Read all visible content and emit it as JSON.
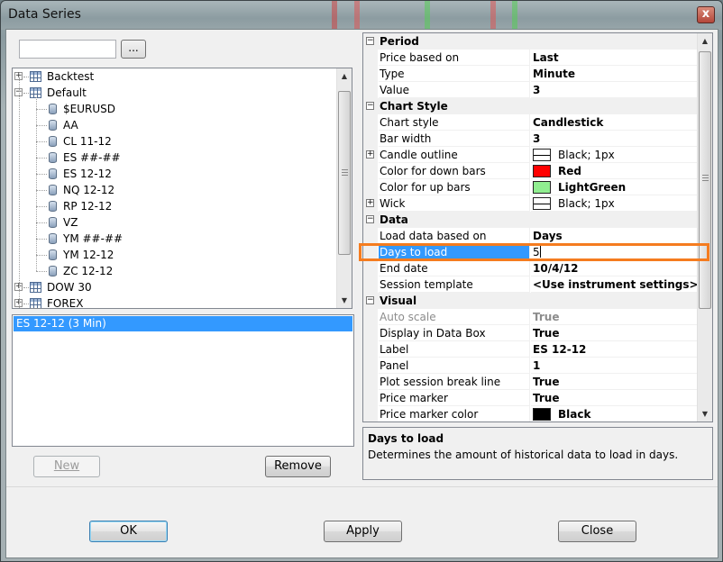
{
  "window": {
    "title": "Data Series",
    "close_label": "x"
  },
  "left": {
    "search": {
      "value": "",
      "placeholder": ""
    },
    "browse_label": "...",
    "tree": [
      {
        "label": "Backtest",
        "type": "folder",
        "expander": "+"
      },
      {
        "label": "Default",
        "type": "folder",
        "expander": "−"
      },
      {
        "label": "$EURUSD",
        "type": "instrument"
      },
      {
        "label": "AA",
        "type": "instrument"
      },
      {
        "label": "CL 11-12",
        "type": "instrument"
      },
      {
        "label": "ES ##-##",
        "type": "instrument"
      },
      {
        "label": "ES 12-12",
        "type": "instrument"
      },
      {
        "label": "NQ 12-12",
        "type": "instrument"
      },
      {
        "label": "RP 12-12",
        "type": "instrument"
      },
      {
        "label": "VZ",
        "type": "instrument"
      },
      {
        "label": "YM ##-##",
        "type": "instrument"
      },
      {
        "label": "YM 12-12",
        "type": "instrument"
      },
      {
        "label": "ZC 12-12",
        "type": "instrument"
      },
      {
        "label": "DOW 30",
        "type": "folder",
        "expander": "+"
      },
      {
        "label": "FOREX",
        "type": "folder",
        "expander": "+"
      }
    ],
    "series": [
      "ES 12-12 (3 Min)"
    ],
    "new_label": "New",
    "remove_label": "Remove"
  },
  "properties": {
    "categories": [
      {
        "name": "Period",
        "expander": "−",
        "rows": [
          {
            "name": "Price based on",
            "value": "Last"
          },
          {
            "name": "Type",
            "value": "Minute"
          },
          {
            "name": "Value",
            "value": "3"
          }
        ]
      },
      {
        "name": "Chart Style",
        "expander": "−",
        "rows": [
          {
            "name": "Chart style",
            "value": "Candlestick"
          },
          {
            "name": "Bar width",
            "value": "3"
          },
          {
            "name": "Candle outline",
            "value": "Black; 1px",
            "expander": "+",
            "swatch": "line"
          },
          {
            "name": "Color for down bars",
            "value": "Red",
            "swatch": "#ff0000"
          },
          {
            "name": "Color for up bars",
            "value": "LightGreen",
            "swatch": "#90ee90"
          },
          {
            "name": "Wick",
            "value": "Black; 1px",
            "expander": "+",
            "swatch": "line"
          }
        ]
      },
      {
        "name": "Data",
        "expander": "−",
        "rows": [
          {
            "name": "Load data based on",
            "value": "Days"
          },
          {
            "name": "Days to load",
            "value": "5",
            "selected": true
          },
          {
            "name": "End date",
            "value": "10/4/12"
          },
          {
            "name": "Session template",
            "value": "<Use instrument settings>"
          }
        ]
      },
      {
        "name": "Visual",
        "expander": "−",
        "rows": [
          {
            "name": "Auto scale",
            "value": "True",
            "dim": true
          },
          {
            "name": "Display in Data Box",
            "value": "True"
          },
          {
            "name": "Label",
            "value": "ES 12-12"
          },
          {
            "name": "Panel",
            "value": "1"
          },
          {
            "name": "Plot session break line",
            "value": "True"
          },
          {
            "name": "Price marker",
            "value": "True"
          },
          {
            "name": "Price marker color",
            "value": "Black",
            "swatch": "#000000"
          }
        ]
      }
    ],
    "description": {
      "title": "Days to load",
      "text": "Determines the amount of historical data to load in days."
    }
  },
  "footer": {
    "ok_label": "OK",
    "apply_label": "Apply",
    "close_label": "Close"
  },
  "colors": {
    "selection": "#3399ff",
    "highlight_outline": "#f57c1f",
    "category_bg": "#f0f0f0"
  }
}
